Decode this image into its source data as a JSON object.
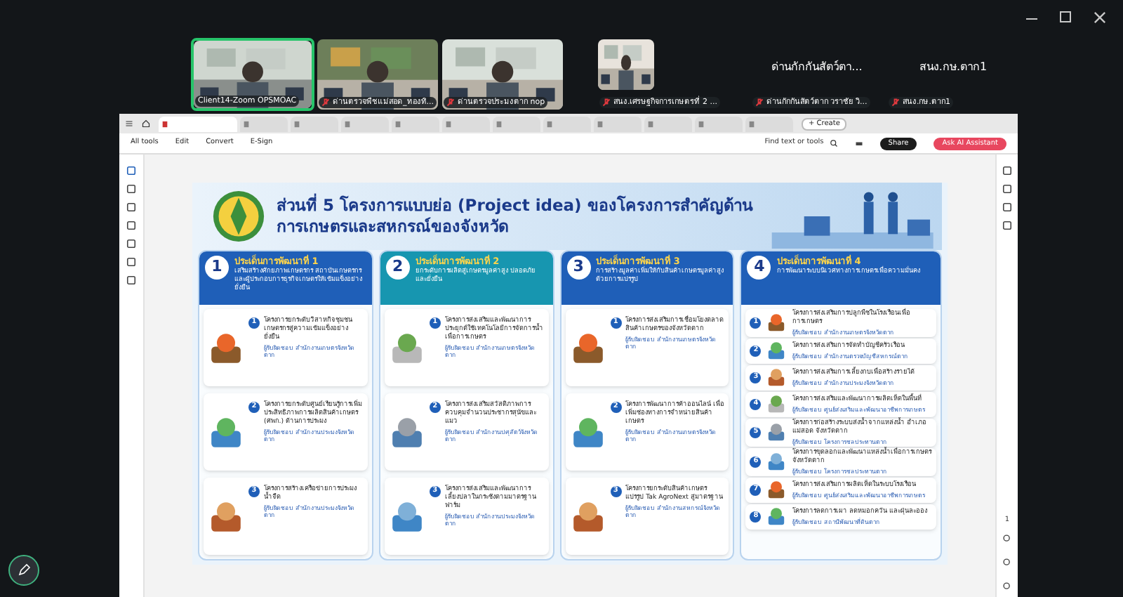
{
  "participants": [
    {
      "name": "Client14-Zoom OPSMOAC",
      "kind": "video",
      "speaking": true
    },
    {
      "name": "ด่านตรวจพืชแม่สอด_ทองทิ...",
      "kind": "video",
      "speaking": false
    },
    {
      "name": "ด่านตรวจประมงตาก nop",
      "kind": "video",
      "speaking": false
    },
    {
      "name": "สนง.เศรษฐกิจการเกษตรที่ 2 ...",
      "kind": "video",
      "speaking": false
    },
    {
      "name": "ด่านกักกันสัตว์ตาก วราชัย วิ...",
      "kind": "text",
      "title": "ด่านกักกันสัตว์ตา...",
      "speaking": false
    },
    {
      "name": "สนง.กษ.ตาก1",
      "kind": "text",
      "title": "สนง.กษ.ตาก1",
      "speaking": false
    }
  ],
  "browser": {
    "tabs": [
      {
        "selected": true
      },
      {
        "selected": false
      },
      {
        "selected": false
      },
      {
        "selected": false
      },
      {
        "selected": false
      },
      {
        "selected": false
      },
      {
        "selected": false
      },
      {
        "selected": false
      },
      {
        "selected": false
      },
      {
        "selected": false
      },
      {
        "selected": false
      },
      {
        "selected": false
      }
    ],
    "new_tab": "+ Create",
    "menu": [
      "All tools",
      "Edit",
      "Convert",
      "E-Sign"
    ],
    "search": {
      "placeholder": "Find text or tools"
    },
    "share": "Share",
    "ai": "Ask AI Assistant"
  },
  "page_info": {
    "current": "1"
  },
  "slide": {
    "title_1": "ส่วนที่ 5  โครงการแบบย่อ (Project idea) ของโครงการสำคัญด้าน",
    "title_2": "การเกษตรและสหกรณ์ของจังหวัด",
    "columns": [
      {
        "number": "1",
        "heading": "ประเด็นการพัฒนาที่ 1",
        "subtitle": "เสริมสร้างศักยภาพเกษตรกร สถาบันเกษตรกร และผู้ประกอบการธุรกิจเกษตรให้เข้มแข็งอย่างยั่งยืน",
        "color": "#1f5fb8",
        "items": [
          {
            "number": "1",
            "text": "โครงการยกระดับวิสาหกิจชุมชนเกษตรกรสู่ความเข้มแข็งอย่างยั่งยืน",
            "owner": "ผู้รับผิดชอบ  สำนักงานเกษตรจังหวัดตาก"
          },
          {
            "number": "2",
            "text": "โครงการยกระดับศูนย์เรียนรู้การเพิ่มประสิทธิภาพการผลิตสินค้าเกษตร (ศพก.) ด้านการประมง",
            "owner": "ผู้รับผิดชอบ  สำนักงานประมงจังหวัดตาก"
          },
          {
            "number": "3",
            "text": "โครงการสร้างเครือข่ายการประมงน้ำจืด",
            "owner": "ผู้รับผิดชอบ  สำนักงานประมงจังหวัดตาก"
          }
        ]
      },
      {
        "number": "2",
        "heading": "ประเด็นการพัฒนาที่ 2",
        "subtitle": "ยกระดับการผลิตสู่เกษตรมูลค่าสูง ปลอดภัย และยั่งยืน",
        "color": "#1796b0",
        "items": [
          {
            "number": "1",
            "text": "โครงการส่งเสริมและพัฒนาการประยุกต์ใช้เทคโนโลยีการจัดการน้ำเพื่อการเกษตร",
            "owner": "ผู้รับผิดชอบ  สำนักงานเกษตรจังหวัดตาก"
          },
          {
            "number": "2",
            "text": "โครงการส่งเสริมสวัสดิภาพการควบคุมจำนวนประชากรสุนัขและแมว",
            "owner": "ผู้รับผิดชอบ  สำนักงานปศุสัตว์จังหวัดตาก"
          },
          {
            "number": "3",
            "text": "โครงการส่งเสริมและพัฒนาการเลี้ยงปลาในกระชังตามมาตรฐานฟาร์ม",
            "owner": "ผู้รับผิดชอบ  สำนักงานประมงจังหวัดตาก"
          }
        ]
      },
      {
        "number": "3",
        "heading": "ประเด็นการพัฒนาที่ 3",
        "subtitle": "การสร้างมูลค่าเพิ่มให้กับสินค้าเกษตรมูลค่าสูง ด้วยการแปรรูป",
        "color": "#1f5fb8",
        "items": [
          {
            "number": "1",
            "text": "โครงการส่งเสริมการเชื่อมโยงตลาดสินค้าเกษตรของจังหวัดตาก",
            "owner": "ผู้รับผิดชอบ  สำนักงานเกษตรจังหวัดตาก"
          },
          {
            "number": "2",
            "text": "โครงการพัฒนาการค้าออนไลน์ เพื่อเพิ่มช่องทางการจำหน่ายสินค้าเกษตร",
            "owner": "ผู้รับผิดชอบ  สำนักงานเกษตรจังหวัดตาก"
          },
          {
            "number": "3",
            "text": "โครงการยกระดับสินค้าเกษตรแปรรูป Tak AgroNext สู่มาตรฐาน",
            "owner": "ผู้รับผิดชอบ  สำนักงานสหกรณ์จังหวัดตาก"
          }
        ]
      },
      {
        "number": "4",
        "heading": "ประเด็นการพัฒนาที่ 4",
        "subtitle": "การพัฒนาระบบนิเวศทางการเกษตรเพื่อความมั่นคง",
        "color": "#1f5fb8",
        "items": [
          {
            "number": "1",
            "text": "โครงการส่งเสริมการปลูกพืชในโรงเรือนเพื่อการเกษตร",
            "owner": "ผู้รับผิดชอบ  สำนักงานเกษตรจังหวัดตาก"
          },
          {
            "number": "2",
            "text": "โครงการส่งเสริมการจัดทำบัญชีครัวเรือน",
            "owner": "ผู้รับผิดชอบ  สำนักงานตรวจบัญชีสหกรณ์ตาก"
          },
          {
            "number": "3",
            "text": "โครงการส่งเสริมการเลี้ยงกบเพื่อสร้างรายได้",
            "owner": "ผู้รับผิดชอบ  สำนักงานประมงจังหวัดตาก"
          },
          {
            "number": "4",
            "text": "โครงการส่งเสริมและพัฒนาการผลิตเห็ดในพื้นที่",
            "owner": "ผู้รับผิดชอบ  ศูนย์ส่งเสริมและพัฒนาอาชีพการเกษตร"
          },
          {
            "number": "5",
            "text": "โครงการก่อสร้างระบบส่งน้ำจากแหล่งน้ำ อำเภอแม่สอด จังหวัดตาก",
            "owner": "ผู้รับผิดชอบ  โครงการชลประทานตาก"
          },
          {
            "number": "6",
            "text": "โครงการขุดลอกและพัฒนาแหล่งน้ำเพื่อการเกษตร จังหวัดตาก",
            "owner": "ผู้รับผิดชอบ  โครงการชลประทานตาก"
          },
          {
            "number": "7",
            "text": "โครงการส่งเสริมการผลิตเห็ดในระบบโรงเรือน",
            "owner": "ผู้รับผิดชอบ  ศูนย์ส่งเสริมและพัฒนาอาชีพการเกษตร"
          },
          {
            "number": "8",
            "text": "โครงการลดการเผา ลดหมอกควัน และฝุ่นละออง",
            "owner": "ผู้รับผิดชอบ  สถานีพัฒนาที่ดินตาก"
          }
        ]
      }
    ]
  }
}
